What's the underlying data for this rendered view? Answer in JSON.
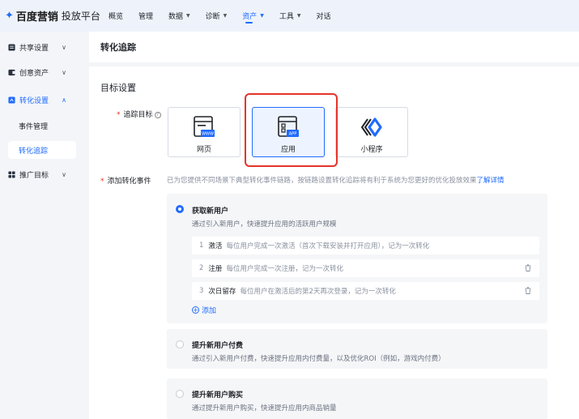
{
  "topbar": {
    "brand": "百度营销",
    "platform": "投放平台",
    "nav": [
      {
        "label": "概览",
        "dropdown": false,
        "active": false
      },
      {
        "label": "管理",
        "dropdown": false,
        "active": false
      },
      {
        "label": "数据",
        "dropdown": true,
        "active": false
      },
      {
        "label": "诊断",
        "dropdown": true,
        "active": false
      },
      {
        "label": "资产",
        "dropdown": true,
        "active": true
      },
      {
        "label": "工具",
        "dropdown": true,
        "active": false
      },
      {
        "label": "对话",
        "dropdown": false,
        "active": false
      }
    ]
  },
  "sidebar": {
    "groups": [
      {
        "label": "共享设置",
        "icon": "share-settings-icon",
        "expanded": false
      },
      {
        "label": "创意资产",
        "icon": "creative-asset-icon",
        "expanded": false
      },
      {
        "label": "转化设置",
        "icon": "conversion-settings-icon",
        "expanded": true
      },
      {
        "label": "推广目标",
        "icon": "grid-icon",
        "expanded": false
      }
    ],
    "sub_items": [
      {
        "label": "事件管理",
        "active": false
      },
      {
        "label": "转化追踪",
        "active": true
      }
    ]
  },
  "page": {
    "title": "转化追踪",
    "section_title": "目标设置",
    "track_target_label": "追踪目标",
    "add_event_label": "添加转化事件",
    "targets": [
      {
        "label": "网页",
        "badge": "WWW",
        "selected": false
      },
      {
        "label": "应用",
        "badge": "APP",
        "selected": true
      },
      {
        "label": "小程序",
        "selected": false
      }
    ],
    "event_hint": "已为您提供不同场景下典型转化事件链路，按链路设置转化追踪将有利于系统为您更好的优化投放效果",
    "event_hint_link": "了解详情",
    "goals": [
      {
        "title": "获取新用户",
        "desc": "通过引入新用户，快速提升应用的活跃用户规模",
        "checked": true,
        "steps": [
          {
            "num": "1",
            "name": "激活",
            "desc": "每位用户完成一次激活（首次下载安装并打开应用），记为一次转化",
            "deletable": false
          },
          {
            "num": "2",
            "name": "注册",
            "desc": "每位用户完成一次注册，记为一次转化",
            "deletable": true
          },
          {
            "num": "3",
            "name": "次日留存",
            "desc": "每位用户在激活后的第2天再次登录，记为一次转化",
            "deletable": true
          }
        ],
        "add_label": "添加"
      },
      {
        "title": "提升新用户付费",
        "desc": "通过引入新用户付费，快速提升应用内付费量，以及优化ROI（例如，游戏内付费）",
        "checked": false
      },
      {
        "title": "提升新用户购买",
        "desc": "通过提升新用户购买，快速提升应用内商品销量",
        "checked": false
      }
    ]
  },
  "colors": {
    "accent": "#1f6bff",
    "highlight": "#e6332a",
    "required": "#e8341c"
  }
}
